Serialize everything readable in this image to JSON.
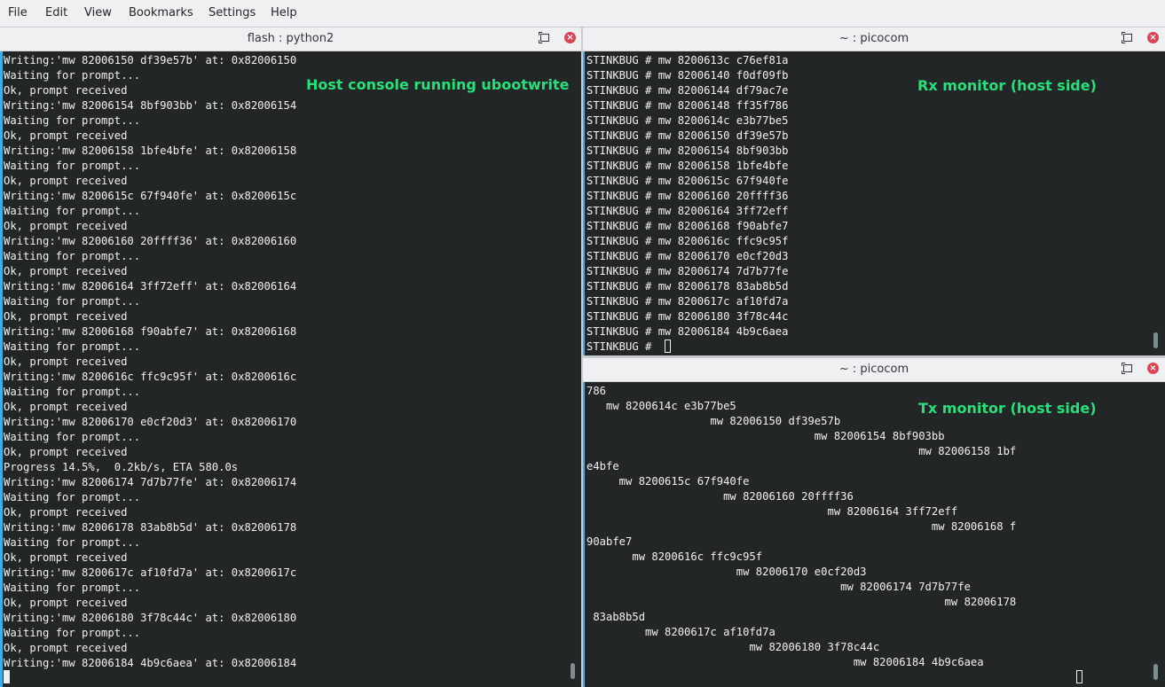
{
  "menu": [
    "File",
    "Edit",
    "View",
    "Bookmarks",
    "Settings",
    "Help"
  ],
  "panes": {
    "left": {
      "title": "flash : python2",
      "annotation": "Host console running ubootwrite",
      "lines": [
        "Writing:'mw 82006150 df39e57b' at: 0x82006150",
        "Waiting for prompt...",
        "Ok, prompt received",
        "Writing:'mw 82006154 8bf903bb' at: 0x82006154",
        "Waiting for prompt...",
        "Ok, prompt received",
        "Writing:'mw 82006158 1bfe4bfe' at: 0x82006158",
        "Waiting for prompt...",
        "Ok, prompt received",
        "Writing:'mw 8200615c 67f940fe' at: 0x8200615c",
        "Waiting for prompt...",
        "Ok, prompt received",
        "Writing:'mw 82006160 20ffff36' at: 0x82006160",
        "Waiting for prompt...",
        "Ok, prompt received",
        "Writing:'mw 82006164 3ff72eff' at: 0x82006164",
        "Waiting for prompt...",
        "Ok, prompt received",
        "Writing:'mw 82006168 f90abfe7' at: 0x82006168",
        "Waiting for prompt...",
        "Ok, prompt received",
        "Writing:'mw 8200616c ffc9c95f' at: 0x8200616c",
        "Waiting for prompt...",
        "Ok, prompt received",
        "Writing:'mw 82006170 e0cf20d3' at: 0x82006170",
        "Waiting for prompt...",
        "Ok, prompt received",
        "Progress 14.5%,  0.2kb/s, ETA 580.0s",
        "Writing:'mw 82006174 7d7b77fe' at: 0x82006174",
        "Waiting for prompt...",
        "Ok, prompt received",
        "Writing:'mw 82006178 83ab8b5d' at: 0x82006178",
        "Waiting for prompt...",
        "Ok, prompt received",
        "Writing:'mw 8200617c af10fd7a' at: 0x8200617c",
        "Waiting for prompt...",
        "Ok, prompt received",
        "Writing:'mw 82006180 3f78c44c' at: 0x82006180",
        "Waiting for prompt...",
        "Ok, prompt received",
        "Writing:'mw 82006184 4b9c6aea' at: 0x82006184"
      ]
    },
    "rx": {
      "title": "~ : picocom",
      "annotation": "Rx monitor (host side)",
      "lines": [
        "STINKBUG # mw 8200613c c76ef81a",
        "STINKBUG # mw 82006140 f0df09fb",
        "STINKBUG # mw 82006144 df79ac7e",
        "STINKBUG # mw 82006148 ff35f786",
        "STINKBUG # mw 8200614c e3b77be5",
        "STINKBUG # mw 82006150 df39e57b",
        "STINKBUG # mw 82006154 8bf903bb",
        "STINKBUG # mw 82006158 1bfe4bfe",
        "STINKBUG # mw 8200615c 67f940fe",
        "STINKBUG # mw 82006160 20ffff36",
        "STINKBUG # mw 82006164 3ff72eff",
        "STINKBUG # mw 82006168 f90abfe7",
        "STINKBUG # mw 8200616c ffc9c95f",
        "STINKBUG # mw 82006170 e0cf20d3",
        "STINKBUG # mw 82006174 7d7b77fe",
        "STINKBUG # mw 82006178 83ab8b5d",
        "STINKBUG # mw 8200617c af10fd7a",
        "STINKBUG # mw 82006180 3f78c44c",
        "STINKBUG # mw 82006184 4b9c6aea",
        "STINKBUG # "
      ]
    },
    "tx": {
      "title": "~ : picocom",
      "annotation": "Tx monitor (host side)",
      "lines": [
        "786",
        "   mw 8200614c e3b77be5",
        "                   mw 82006150 df39e57b",
        "                                   mw 82006154 8bf903bb",
        "                                                   mw 82006158 1bf",
        "e4bfe",
        "     mw 8200615c 67f940fe",
        "                     mw 82006160 20ffff36",
        "                                     mw 82006164 3ff72eff",
        "                                                     mw 82006168 f",
        "90abfe7",
        "       mw 8200616c ffc9c95f",
        "                       mw 82006170 e0cf20d3",
        "                                       mw 82006174 7d7b77fe",
        "                                                       mw 82006178",
        " 83ab8b5d",
        "         mw 8200617c af10fd7a",
        "                         mw 82006180 3f78c44c",
        "                                         mw 82006184 4b9c6aea"
      ]
    }
  }
}
